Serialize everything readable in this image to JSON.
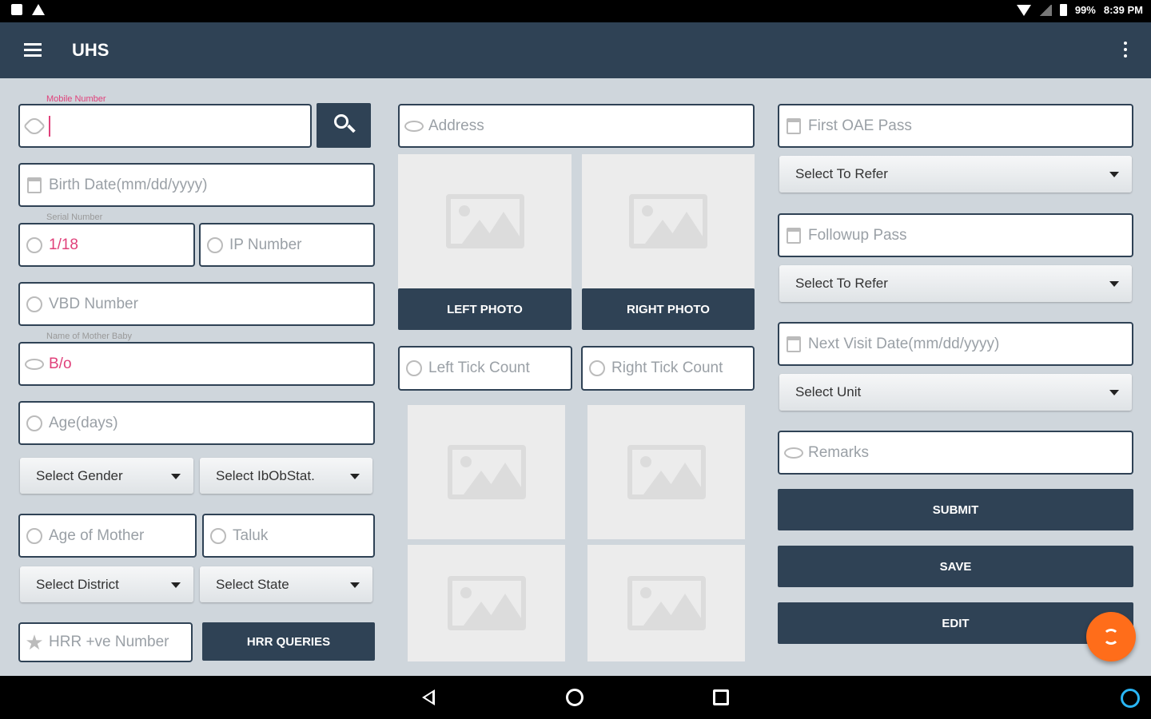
{
  "status_bar": {
    "battery": "99%",
    "time": "8:39 PM"
  },
  "app_bar": {
    "title": "UHS",
    "menu_icon": "hamburger-menu-icon",
    "overflow_icon": "more-vert-icon"
  },
  "left_column": {
    "mobile_label": "Mobile Number",
    "mobile_value": "",
    "birth_date_placeholder": "Birth Date(mm/dd/yyyy)",
    "serial_label": "Serial Number",
    "serial_value": "1/18",
    "ip_placeholder": "IP Number",
    "vbd_placeholder": "VBD Number",
    "mother_label": "Name of Mother Baby",
    "mother_value": "B/o",
    "age_days_placeholder": "Age(days)",
    "gender_select": "Select Gender",
    "ibob_select": "Select IbObStat.",
    "age_mother_placeholder": "Age of Mother",
    "taluk_placeholder": "Taluk",
    "district_select": "Select District",
    "state_select": "Select State",
    "hrr_placeholder": "HRR +ve Number",
    "hrr_queries_button": "HRR QUERIES"
  },
  "middle_column": {
    "address_placeholder": "Address",
    "left_photo_button": "LEFT PHOTO",
    "right_photo_button": "RIGHT PHOTO",
    "left_tick_placeholder": "Left Tick Count",
    "right_tick_placeholder": "Right Tick Count"
  },
  "right_column": {
    "first_oae_placeholder": "First OAE Pass",
    "refer_select_1": "Select To Refer",
    "followup_placeholder": "Followup Pass",
    "refer_select_2": "Select To Refer",
    "next_visit_placeholder": "Next Visit Date(mm/dd/yyyy)",
    "unit_select": "Select Unit",
    "remarks_placeholder": "Remarks",
    "submit_button": "SUBMIT",
    "save_button": "SAVE",
    "edit_button": "EDIT"
  },
  "colors": {
    "primary": "#2f4255",
    "accent": "#e0407a",
    "fab": "#ff6d1a",
    "background": "#cfd6dc"
  }
}
